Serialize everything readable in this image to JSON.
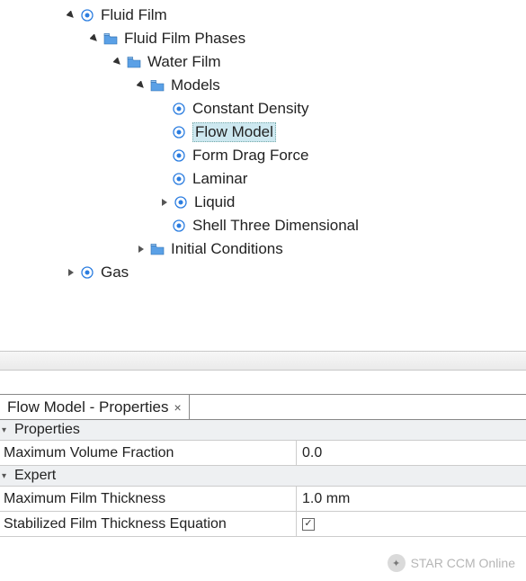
{
  "tree": {
    "fluid_film": "Fluid Film",
    "fluid_film_phases": "Fluid Film Phases",
    "water_film": "Water Film",
    "models": "Models",
    "constant_density": "Constant Density",
    "flow_model": "Flow Model",
    "form_drag_force": "Form Drag Force",
    "laminar": "Laminar",
    "liquid": "Liquid",
    "shell_three_dim": "Shell Three Dimensional",
    "initial_conditions": "Initial Conditions",
    "gas": "Gas"
  },
  "tab": {
    "title": "Flow Model - Properties"
  },
  "sections": {
    "properties": "Properties",
    "expert": "Expert"
  },
  "props": {
    "max_vol_frac": {
      "name": "Maximum Volume Fraction",
      "value": "0.0"
    },
    "max_film_thick": {
      "name": "Maximum Film Thickness",
      "value": "1.0 mm"
    },
    "stab_eq": {
      "name": "Stabilized Film Thickness Equation",
      "checked": true
    }
  },
  "watermark": "STAR CCM Online"
}
